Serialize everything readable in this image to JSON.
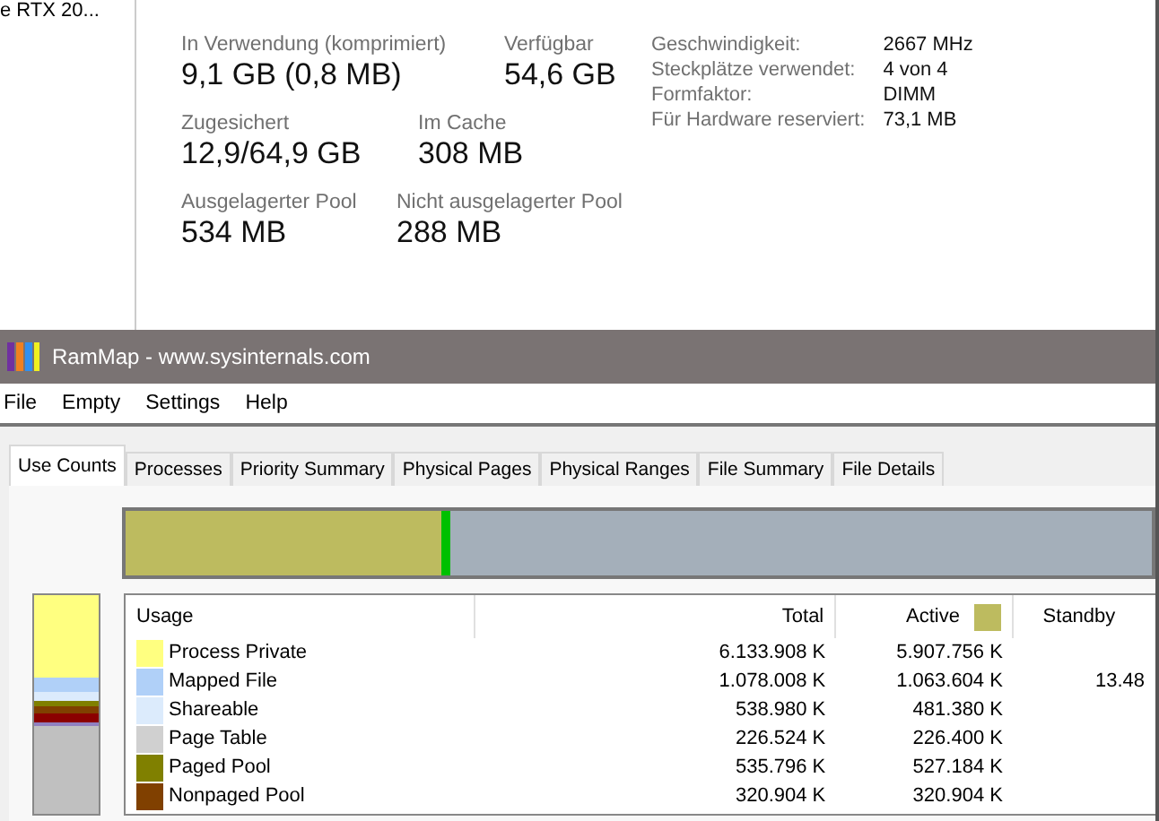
{
  "background_window": {
    "cut_text": "e RTX 20...",
    "stats": [
      {
        "label": "In Verwendung (komprimiert)",
        "value": "9,1 GB (0,8 MB)"
      },
      {
        "label": "Verfügbar",
        "value": "54,6 GB"
      },
      {
        "label": "Zugesichert",
        "value": "12,9/64,9 GB"
      },
      {
        "label": "Im Cache",
        "value": "308 MB"
      },
      {
        "label": "Ausgelagerter Pool",
        "value": "534 MB"
      },
      {
        "label": "Nicht ausgelagerter Pool",
        "value": "288 MB"
      }
    ],
    "details": [
      {
        "label": "Geschwindigkeit:",
        "value": "2667 MHz"
      },
      {
        "label": "Steckplätze verwendet:",
        "value": "4 von 4"
      },
      {
        "label": "Formfaktor:",
        "value": "DIMM"
      },
      {
        "label": "Für Hardware reserviert:",
        "value": "73,1 MB"
      }
    ]
  },
  "window": {
    "title": "RamMap - www.sysinternals.com"
  },
  "menu": [
    "File",
    "Empty",
    "Settings",
    "Help"
  ],
  "tabs": [
    {
      "label": "Use Counts",
      "selected": true
    },
    {
      "label": "Processes",
      "selected": false
    },
    {
      "label": "Priority Summary",
      "selected": false
    },
    {
      "label": "Physical Pages",
      "selected": false
    },
    {
      "label": "Physical Ranges",
      "selected": false
    },
    {
      "label": "File Summary",
      "selected": false
    },
    {
      "label": "File Details",
      "selected": false
    }
  ],
  "table": {
    "columns": [
      {
        "label": "Usage"
      },
      {
        "label": "Total"
      },
      {
        "label": "Active",
        "color": "#bdbb5f"
      },
      {
        "label": "Standby"
      }
    ],
    "rows": [
      {
        "usage": "Process Private",
        "color": "#ffff80",
        "total": "6.133.908 K",
        "active": "5.907.756 K",
        "standby": ""
      },
      {
        "usage": "Mapped File",
        "color": "#b0d0f8",
        "total": "1.078.008 K",
        "active": "1.063.604 K",
        "standby": "13.48"
      },
      {
        "usage": "Shareable",
        "color": "#dcebfc",
        "total": "538.980 K",
        "active": "481.380 K",
        "standby": ""
      },
      {
        "usage": "Page Table",
        "color": "#d0d0d0",
        "total": "226.524 K",
        "active": "226.400 K",
        "standby": ""
      },
      {
        "usage": "Paged Pool",
        "color": "#808000",
        "total": "535.796 K",
        "active": "527.184 K",
        "standby": ""
      },
      {
        "usage": "Nonpaged Pool",
        "color": "#804000",
        "total": "320.904 K",
        "active": "320.904 K",
        "standby": ""
      }
    ]
  }
}
